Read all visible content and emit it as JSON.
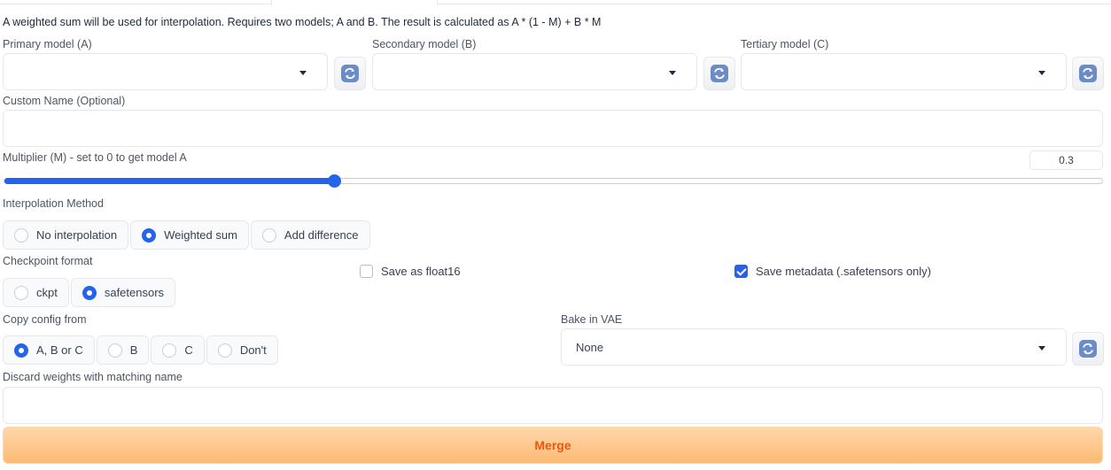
{
  "description": "A weighted sum will be used for interpolation. Requires two models; A and B. The result is calculated as A * (1 - M) + B * M",
  "models": {
    "primary_label": "Primary model (A)",
    "primary_value": "",
    "secondary_label": "Secondary model (B)",
    "secondary_value": "",
    "tertiary_label": "Tertiary model (C)",
    "tertiary_value": ""
  },
  "custom_name": {
    "label": "Custom Name (Optional)",
    "value": ""
  },
  "multiplier": {
    "label": "Multiplier (M) - set to 0 to get model A",
    "value": "0.3",
    "min": 0,
    "max": 1,
    "fraction": 0.3
  },
  "interpolation": {
    "label": "Interpolation Method",
    "options": [
      "No interpolation",
      "Weighted sum",
      "Add difference"
    ],
    "selected": "Weighted sum"
  },
  "checkpoint_format": {
    "label": "Checkpoint format",
    "options": [
      "ckpt",
      "safetensors"
    ],
    "selected": "safetensors"
  },
  "save_float16": {
    "label": "Save as float16",
    "checked": false
  },
  "save_metadata": {
    "label": "Save metadata (.safetensors only)",
    "checked": true
  },
  "copy_config": {
    "label": "Copy config from",
    "options": [
      "A, B or C",
      "B",
      "C",
      "Don't"
    ],
    "selected": "A, B or C"
  },
  "bake_vae": {
    "label": "Bake in VAE",
    "value": "None"
  },
  "discard_weights": {
    "label": "Discard weights with matching name",
    "value": ""
  },
  "merge_button": "Merge",
  "icons": {
    "refresh": "refresh-icon",
    "dropdown": "chevron-down-icon"
  },
  "colors": {
    "accent": "#2563eb",
    "merge_text": "#ea580c",
    "merge_bg": "#fdba74"
  }
}
